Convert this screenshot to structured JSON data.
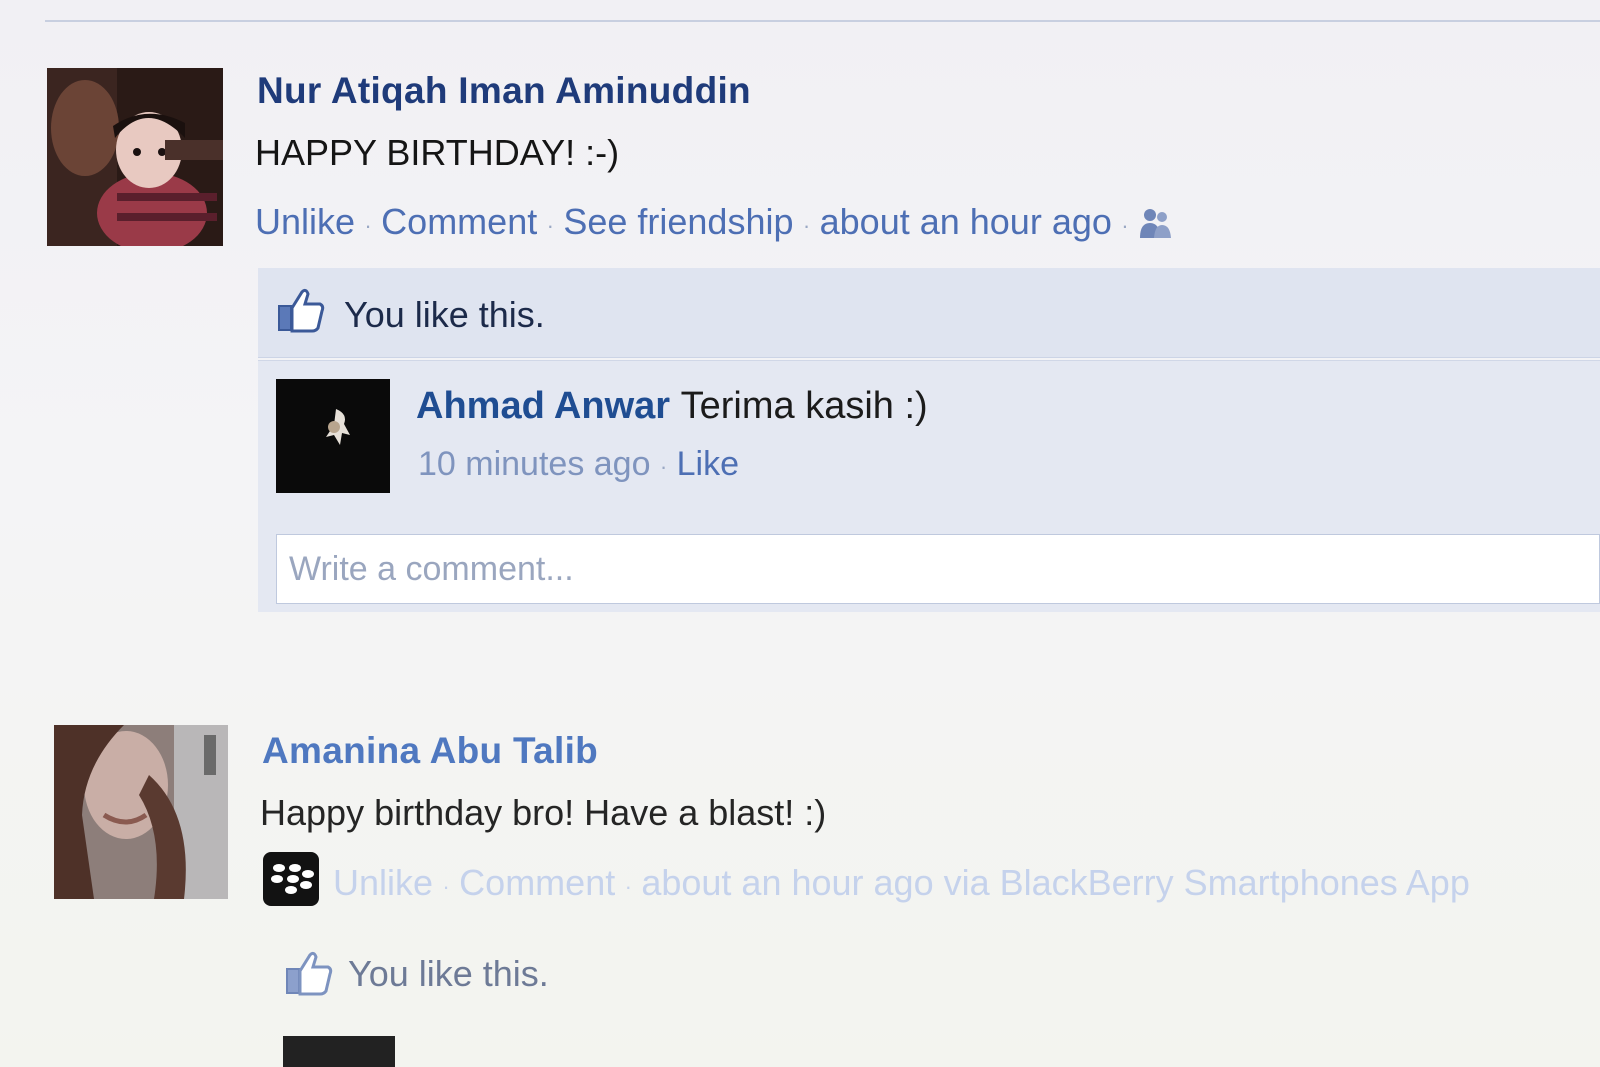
{
  "colors": {
    "link": "#4d6fb4",
    "name": "#1f3b7a",
    "likebox_bg": "#dfe4f0",
    "page_bg": "#f2f2f5"
  },
  "post1": {
    "author": "Nur Atiqah Iman Aminuddin",
    "message": "HAPPY BIRTHDAY! :-)",
    "actions": {
      "unlike": "Unlike",
      "comment": "Comment",
      "see_friendship": "See friendship",
      "timestamp": "about an hour ago",
      "privacy_icon": "friends-icon"
    },
    "likes_text": "You like this.",
    "comment": {
      "author": "Ahmad Anwar",
      "text": "Terima kasih :)",
      "time": "10 minutes ago",
      "like": "Like"
    },
    "write_placeholder": "Write a comment..."
  },
  "post2": {
    "author": "Amanina Abu Talib",
    "message": "Happy birthday bro! Have a blast! :)",
    "app_icon": "blackberry-icon",
    "actions": {
      "unlike": "Unlike",
      "comment": "Comment",
      "timestamp": "about an hour ago via BlackBerry Smartphones App"
    },
    "likes_text": "You like this."
  }
}
